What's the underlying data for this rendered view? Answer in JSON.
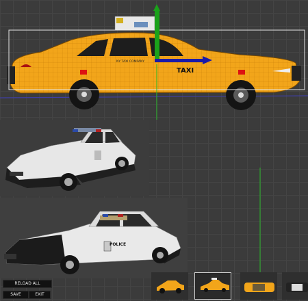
{
  "viewport_main": {
    "taxi_door_text": "NY TAXI COMPANY",
    "taxi_side_text": "TAXI"
  },
  "viewport_police2": {
    "door_text": "POLICE"
  },
  "buttons": {
    "reload_label": "RELOAD ALL",
    "save_label": "SAVE",
    "exit_label": "EXIT"
  },
  "thumbnails": [
    {
      "name": "taxi-side",
      "selected": false
    },
    {
      "name": "taxi-front",
      "selected": true
    },
    {
      "name": "taxi-top",
      "selected": false
    },
    {
      "name": "police-partial",
      "selected": false
    }
  ],
  "colors": {
    "taxi_yellow": "#f2a51a",
    "gizmo_green": "#1aa11a",
    "gizmo_blue": "#1a1aa8",
    "background": "#3b3b3b"
  }
}
